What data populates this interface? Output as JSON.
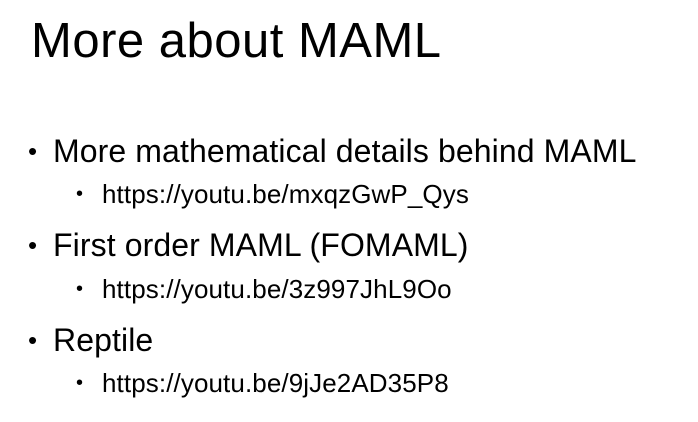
{
  "slide": {
    "title": "More about MAML",
    "bullets": [
      {
        "text": "More mathematical details behind MAML",
        "sub": [
          "https://youtu.be/mxqzGwP_Qys"
        ]
      },
      {
        "text": "First order MAML (FOMAML)",
        "sub": [
          "https://youtu.be/3z997JhL9Oo"
        ]
      },
      {
        "text": "Reptile",
        "sub": [
          "https://youtu.be/9jJe2AD35P8"
        ]
      }
    ],
    "bullet_symbol": "•"
  }
}
